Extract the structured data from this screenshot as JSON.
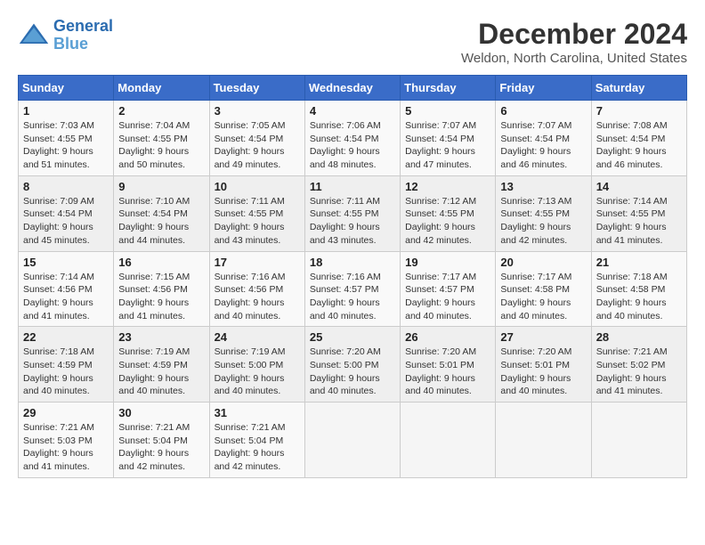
{
  "header": {
    "logo_line1": "General",
    "logo_line2": "Blue",
    "month": "December 2024",
    "location": "Weldon, North Carolina, United States"
  },
  "days_of_week": [
    "Sunday",
    "Monday",
    "Tuesday",
    "Wednesday",
    "Thursday",
    "Friday",
    "Saturday"
  ],
  "weeks": [
    [
      {
        "day": "1",
        "sunrise": "7:03 AM",
        "sunset": "4:55 PM",
        "daylight": "9 hours and 51 minutes."
      },
      {
        "day": "2",
        "sunrise": "7:04 AM",
        "sunset": "4:55 PM",
        "daylight": "9 hours and 50 minutes."
      },
      {
        "day": "3",
        "sunrise": "7:05 AM",
        "sunset": "4:54 PM",
        "daylight": "9 hours and 49 minutes."
      },
      {
        "day": "4",
        "sunrise": "7:06 AM",
        "sunset": "4:54 PM",
        "daylight": "9 hours and 48 minutes."
      },
      {
        "day": "5",
        "sunrise": "7:07 AM",
        "sunset": "4:54 PM",
        "daylight": "9 hours and 47 minutes."
      },
      {
        "day": "6",
        "sunrise": "7:07 AM",
        "sunset": "4:54 PM",
        "daylight": "9 hours and 46 minutes."
      },
      {
        "day": "7",
        "sunrise": "7:08 AM",
        "sunset": "4:54 PM",
        "daylight": "9 hours and 46 minutes."
      }
    ],
    [
      {
        "day": "8",
        "sunrise": "7:09 AM",
        "sunset": "4:54 PM",
        "daylight": "9 hours and 45 minutes."
      },
      {
        "day": "9",
        "sunrise": "7:10 AM",
        "sunset": "4:54 PM",
        "daylight": "9 hours and 44 minutes."
      },
      {
        "day": "10",
        "sunrise": "7:11 AM",
        "sunset": "4:55 PM",
        "daylight": "9 hours and 43 minutes."
      },
      {
        "day": "11",
        "sunrise": "7:11 AM",
        "sunset": "4:55 PM",
        "daylight": "9 hours and 43 minutes."
      },
      {
        "day": "12",
        "sunrise": "7:12 AM",
        "sunset": "4:55 PM",
        "daylight": "9 hours and 42 minutes."
      },
      {
        "day": "13",
        "sunrise": "7:13 AM",
        "sunset": "4:55 PM",
        "daylight": "9 hours and 42 minutes."
      },
      {
        "day": "14",
        "sunrise": "7:14 AM",
        "sunset": "4:55 PM",
        "daylight": "9 hours and 41 minutes."
      }
    ],
    [
      {
        "day": "15",
        "sunrise": "7:14 AM",
        "sunset": "4:56 PM",
        "daylight": "9 hours and 41 minutes."
      },
      {
        "day": "16",
        "sunrise": "7:15 AM",
        "sunset": "4:56 PM",
        "daylight": "9 hours and 41 minutes."
      },
      {
        "day": "17",
        "sunrise": "7:16 AM",
        "sunset": "4:56 PM",
        "daylight": "9 hours and 40 minutes."
      },
      {
        "day": "18",
        "sunrise": "7:16 AM",
        "sunset": "4:57 PM",
        "daylight": "9 hours and 40 minutes."
      },
      {
        "day": "19",
        "sunrise": "7:17 AM",
        "sunset": "4:57 PM",
        "daylight": "9 hours and 40 minutes."
      },
      {
        "day": "20",
        "sunrise": "7:17 AM",
        "sunset": "4:58 PM",
        "daylight": "9 hours and 40 minutes."
      },
      {
        "day": "21",
        "sunrise": "7:18 AM",
        "sunset": "4:58 PM",
        "daylight": "9 hours and 40 minutes."
      }
    ],
    [
      {
        "day": "22",
        "sunrise": "7:18 AM",
        "sunset": "4:59 PM",
        "daylight": "9 hours and 40 minutes."
      },
      {
        "day": "23",
        "sunrise": "7:19 AM",
        "sunset": "4:59 PM",
        "daylight": "9 hours and 40 minutes."
      },
      {
        "day": "24",
        "sunrise": "7:19 AM",
        "sunset": "5:00 PM",
        "daylight": "9 hours and 40 minutes."
      },
      {
        "day": "25",
        "sunrise": "7:20 AM",
        "sunset": "5:00 PM",
        "daylight": "9 hours and 40 minutes."
      },
      {
        "day": "26",
        "sunrise": "7:20 AM",
        "sunset": "5:01 PM",
        "daylight": "9 hours and 40 minutes."
      },
      {
        "day": "27",
        "sunrise": "7:20 AM",
        "sunset": "5:01 PM",
        "daylight": "9 hours and 40 minutes."
      },
      {
        "day": "28",
        "sunrise": "7:21 AM",
        "sunset": "5:02 PM",
        "daylight": "9 hours and 41 minutes."
      }
    ],
    [
      {
        "day": "29",
        "sunrise": "7:21 AM",
        "sunset": "5:03 PM",
        "daylight": "9 hours and 41 minutes."
      },
      {
        "day": "30",
        "sunrise": "7:21 AM",
        "sunset": "5:04 PM",
        "daylight": "9 hours and 42 minutes."
      },
      {
        "day": "31",
        "sunrise": "7:21 AM",
        "sunset": "5:04 PM",
        "daylight": "9 hours and 42 minutes."
      },
      null,
      null,
      null,
      null
    ]
  ]
}
